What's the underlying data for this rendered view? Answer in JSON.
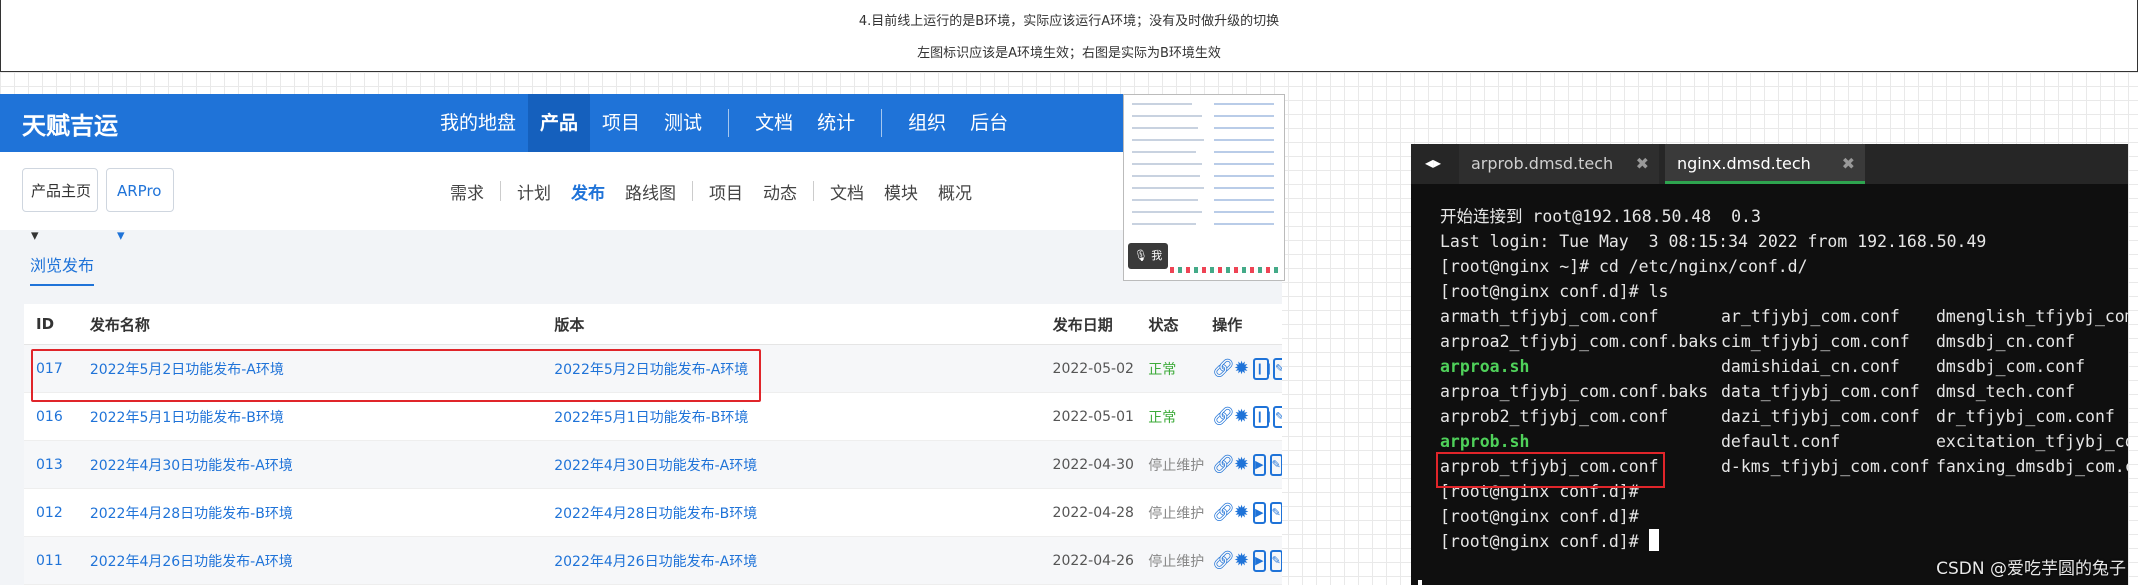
{
  "caption": {
    "line1": "4.目前线上运行的是B环境，实际应该运行A环境；没有及时做升级的切换",
    "line2": "左图标识应该是A环境生效；右图是实际为B环境生效"
  },
  "app": {
    "brand": "天赋吉运",
    "main_nav": [
      "我的地盘",
      "产品",
      "项目",
      "测试",
      "文档",
      "统计",
      "组织",
      "后台"
    ],
    "crumb_product": "产品主页 ▾",
    "crumb_project": "ARPro ▾",
    "sub_nav": [
      "需求",
      "计划",
      "发布",
      "路线图",
      "项目",
      "动态",
      "文档",
      "模块",
      "概况"
    ],
    "browse_tab": "浏览发布",
    "table": {
      "headers": [
        "ID",
        "发布名称",
        "版本",
        "发布日期",
        "状态",
        "操作"
      ],
      "rows": [
        {
          "id": "017",
          "name": "2022年5月2日功能发布-A环境",
          "version": "2022年5月2日功能发布-A环境",
          "date": "2022-05-02",
          "status": "正常"
        },
        {
          "id": "016",
          "name": "2022年5月1日功能发布-B环境",
          "version": "2022年5月1日功能发布-B环境",
          "date": "2022-05-01",
          "status": "正常"
        },
        {
          "id": "013",
          "name": "2022年4月30日功能发布-A环境",
          "version": "2022年4月30日功能发布-A环境",
          "date": "2022-04-30",
          "status": "停止维护"
        },
        {
          "id": "012",
          "name": "2022年4月28日功能发布-B环境",
          "version": "2022年4月28日功能发布-B环境",
          "date": "2022-04-28",
          "status": "停止维护"
        },
        {
          "id": "011",
          "name": "2022年4月26日功能发布-A环境",
          "version": "2022年4月26日功能发布-A环境",
          "date": "2022-04-26",
          "status": "停止维护"
        }
      ]
    }
  },
  "thumb": {
    "mic_label": "我"
  },
  "terminal": {
    "tabs": [
      "arprob.dmsd.tech",
      "nginx.dmsd.tech"
    ],
    "tab_close": "✖",
    "lines": {
      "l1": "开始连接到 root@192.168.50.48  0.3",
      "l2": "Last login: Tue May  3 08:15:34 2022 from 192.168.50.49",
      "l3": "[root@nginx ~]# cd /etc/nginx/conf.d/",
      "l4": "[root@nginx conf.d]# ls"
    },
    "ls": [
      [
        "armath_tfjybj_com.conf",
        "ar_tfjybj_com.conf",
        "dmenglish_tfjybj_com"
      ],
      [
        "arproa2_tfjybj_com.conf.baks",
        "cim_tfjybj_com.conf",
        "dmsdbj_cn.conf"
      ],
      [
        "arproa.sh",
        "damishidai_cn.conf",
        "dmsdbj_com.conf"
      ],
      [
        "arproa_tfjybj_com.conf.baks",
        "data_tfjybj_com.conf",
        "dmsd_tech.conf"
      ],
      [
        "arprob2_tfjybj_com.conf",
        "dazi_tfjybj_com.conf",
        "dr_tfjybj_com.conf"
      ],
      [
        "arprob.sh",
        "default.conf",
        "excitation_tfjybj_co"
      ],
      [
        "arprob_tfjybj_com.conf",
        "d-kms_tfjybj_com.conf",
        "fanxing_dmsdbj_com.co"
      ]
    ],
    "prompt_a": "[root@nginx conf.d]#",
    "prompt_b": "[root@nginx conf.d]#",
    "prompt_c": "[root@nginx conf.d]# "
  },
  "watermark": "CSDN @爱吃芋圆的兔子"
}
